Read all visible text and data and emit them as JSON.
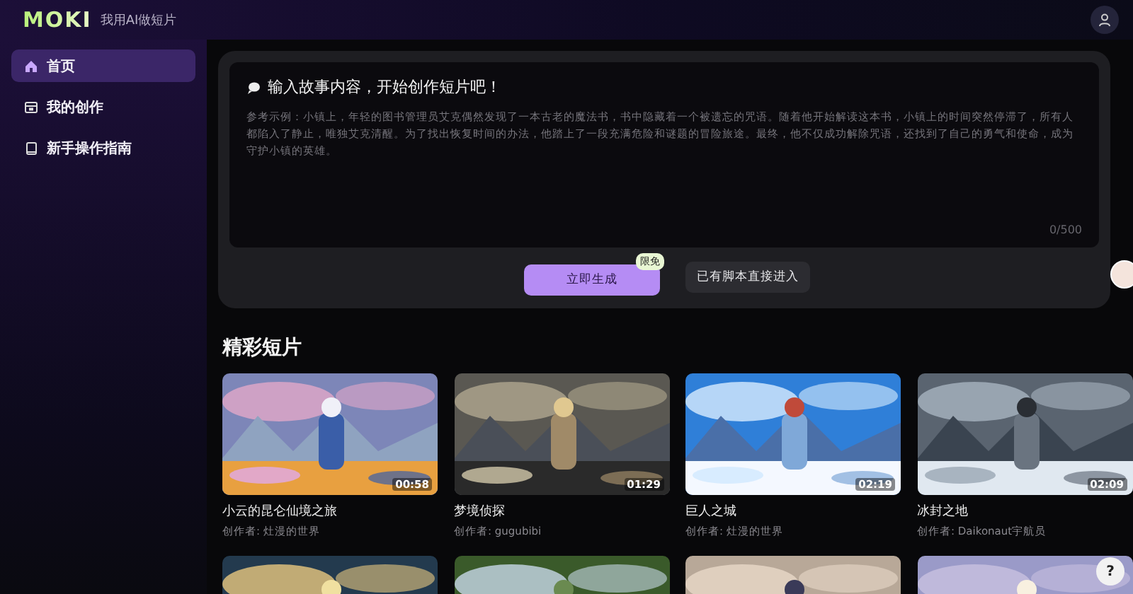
{
  "header": {
    "logo": "MOKI",
    "tagline": "我用AI做短片"
  },
  "sidebar": {
    "items": [
      {
        "label": "首页",
        "selected": true
      },
      {
        "label": "我的创作",
        "selected": false
      },
      {
        "label": "新手操作指南",
        "selected": false
      }
    ]
  },
  "composer": {
    "title": "输入故事内容，开始创作短片吧！",
    "placeholder": "参考示例：小镇上，年轻的图书管理员艾克偶然发现了一本古老的魔法书，书中隐藏着一个被遗忘的咒语。随着他开始解读这本书，小镇上的时间突然停滞了，所有人都陷入了静止，唯独艾克清醒。为了找出恢复时间的办法，他踏上了一段充满危险和谜题的冒险旅途。最终，他不仅成功解除咒语，还找到了自己的勇气和使命，成为守护小镇的英雄。",
    "counter": "0/500",
    "primary_button": "立即生成",
    "badge": "限免",
    "secondary_button": "已有脚本直接进入"
  },
  "section_title": "精彩短片",
  "videos": [
    {
      "kind": "video",
      "title": "小云的昆仑仙境之旅",
      "creator": "创作者: 灶漫的世界",
      "duration": "00:58"
    },
    {
      "kind": "video",
      "title": "梦境侦探",
      "creator": "创作者: gugubibi",
      "duration": "01:29"
    },
    {
      "kind": "video",
      "title": "巨人之城",
      "creator": "创作者: 灶漫的世界",
      "duration": "02:19"
    },
    {
      "kind": "video",
      "title": "冰封之地",
      "creator": "创作者: Daikonaut宇航员",
      "duration": "02:09"
    },
    {
      "kind": "picture"
    },
    {
      "kind": "picture"
    },
    {
      "kind": "picture"
    },
    {
      "kind": "picture"
    }
  ],
  "help_button": "?"
}
